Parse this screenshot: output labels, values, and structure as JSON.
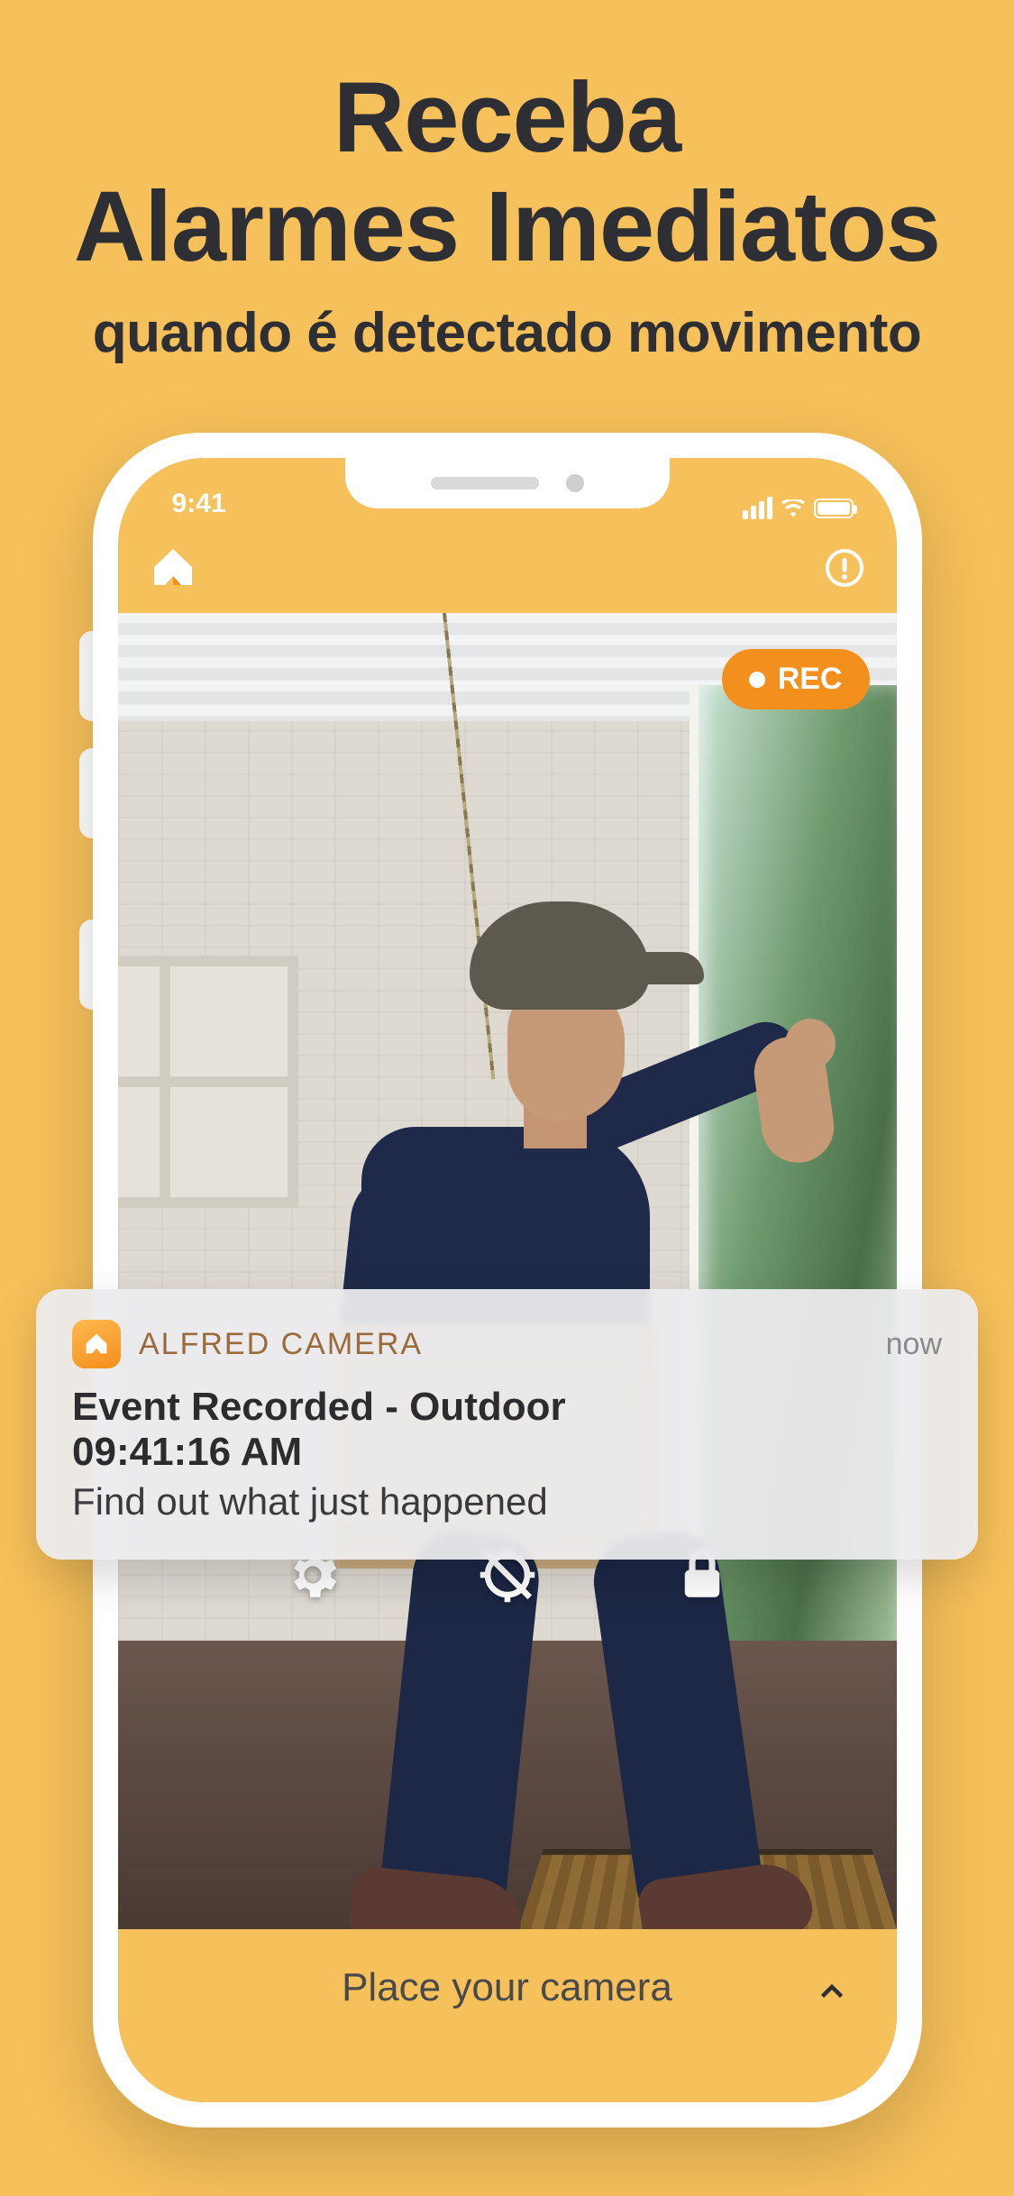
{
  "promo": {
    "headline_line1": "Receba",
    "headline_line2": "Alarmes Imediatos",
    "subhead": "quando é detectado movimento"
  },
  "status": {
    "time": "9:41"
  },
  "rec": {
    "label": "REC"
  },
  "notification": {
    "app_name": "ALFRED CAMERA",
    "time": "now",
    "title": "Event Recorded - Outdoor",
    "subtitle": "09:41:16 AM",
    "body": "Find out what just happened"
  },
  "bottom_bar": {
    "label": "Place your camera"
  },
  "icons": {
    "logo": "alfred-home-icon",
    "info": "alert-circle-icon",
    "settings": "gear-icon",
    "gps": "location-off-icon",
    "lock": "lock-icon",
    "chevron": "chevron-up-icon"
  },
  "colors": {
    "accent": "#f3901d",
    "bg": "#f6c05a"
  }
}
